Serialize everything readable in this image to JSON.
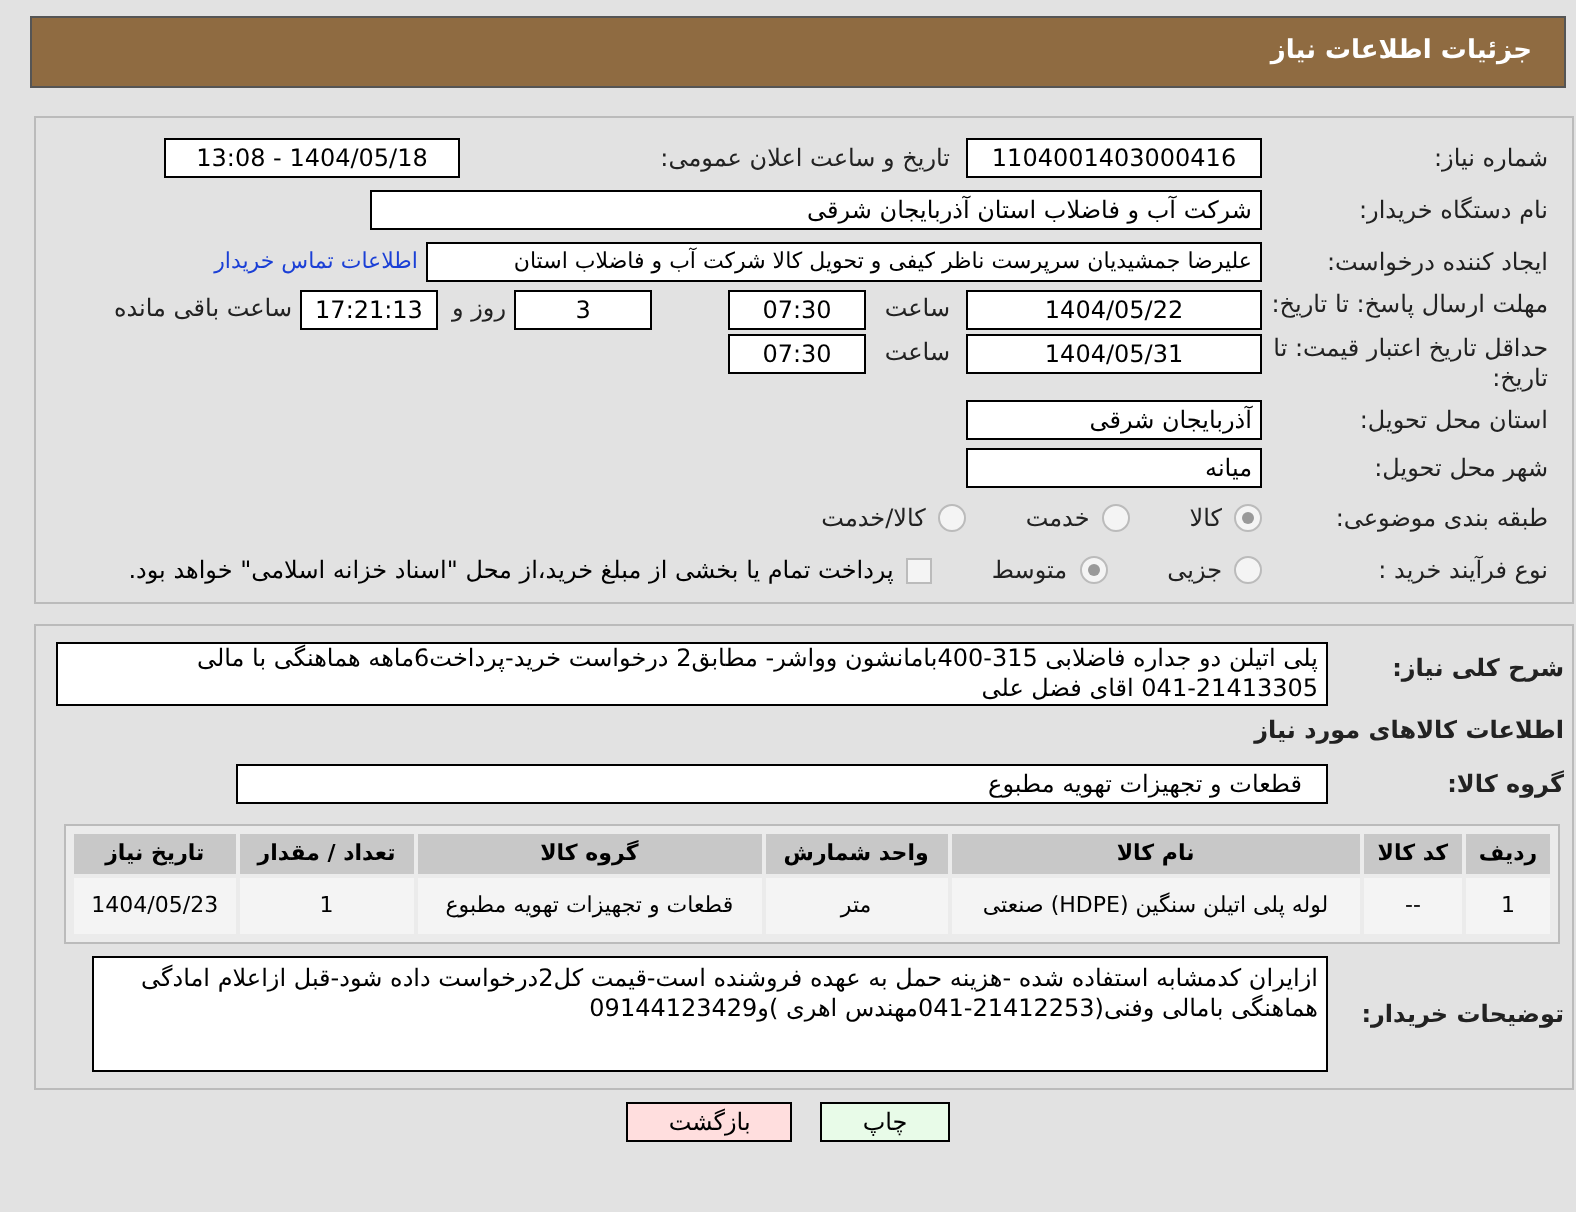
{
  "header": {
    "title": "جزئیات اطلاعات نیاز"
  },
  "need_number": {
    "label": "شماره نیاز:",
    "value": "1104001403000416"
  },
  "announce": {
    "label": "تاریخ و ساعت اعلان عمومی:",
    "value": "1404/05/18 - 13:08"
  },
  "buyer": {
    "label": "نام دستگاه خریدار:",
    "value": "شرکت آب و فاضلاب استان آذربایجان شرقی"
  },
  "requester": {
    "label": "ایجاد کننده درخواست:",
    "value": "علیرضا جمشیدیان سرپرست ناظر کیفی و تحویل کالا شرکت آب و فاضلاب استان",
    "link": "اطلاعات تماس خریدار"
  },
  "deadline": {
    "label": "مهلت ارسال پاسخ: تا تاریخ:",
    "date": "1404/05/22",
    "time_label": "ساعت",
    "time": "07:30",
    "days": "3",
    "days_label": "روز و",
    "remaining": "17:21:13",
    "remaining_label": "ساعت باقی مانده"
  },
  "validity": {
    "label": "حداقل تاریخ اعتبار قیمت: تا تاریخ:",
    "date": "1404/05/31",
    "time_label": "ساعت",
    "time": "07:30"
  },
  "province": {
    "label": "استان محل تحویل:",
    "value": "آذربایجان شرقی"
  },
  "city": {
    "label": "شهر محل تحویل:",
    "value": "میانه"
  },
  "category": {
    "label": "طبقه بندی موضوعی:",
    "options": [
      {
        "label": "کالا",
        "selected": true
      },
      {
        "label": "خدمت",
        "selected": false
      },
      {
        "label": "کالا/خدمت",
        "selected": false
      }
    ]
  },
  "process": {
    "label": "نوع فرآیند خرید :",
    "options": [
      {
        "label": "جزیی",
        "selected": false
      },
      {
        "label": "متوسط",
        "selected": true
      }
    ],
    "payment": {
      "label": "پرداخت تمام یا بخشی از مبلغ خرید،از محل \"اسناد خزانه اسلامی\" خواهد بود.",
      "checked": false
    }
  },
  "description": {
    "label": "شرح کلی نیاز:",
    "value": "پلی اتیلن دو جداره  فاضلابی 315-400بامانشون وواشر- مطابق2 درخواست خرید-پرداخت6ماهه هماهنگی با مالی 21413305-041 اقای فضل علی"
  },
  "goods_title": "اطلاعات کالاهای مورد نیاز",
  "goods_group": {
    "label": "گروه کالا:",
    "value": "قطعات و تجهیزات تهویه مطبوع"
  },
  "table": {
    "columns": [
      "ردیف",
      "کد کالا",
      "نام کالا",
      "واحد شمارش",
      "گروه کالا",
      "تعداد / مقدار",
      "تاریخ نیاز"
    ],
    "rows": [
      [
        "1",
        "--",
        "لوله پلی اتیلن سنگین (HDPE) صنعتی",
        "متر",
        "قطعات و تجهیزات تهویه مطبوع",
        "1",
        "1404/05/23"
      ]
    ]
  },
  "buyer_notes": {
    "label": "توضیحات خریدار:",
    "value": "ازایران کدمشابه استفاده شده -هزینه حمل به عهده فروشنده است-قیمت کل2درخواست داده شود-قبل ازاعلام امادگی هماهنگی بامالی وفنی(21412253-041مهندس اهری )و09144123429"
  },
  "buttons": [
    {
      "label": "چاپ",
      "kind": "print"
    },
    {
      "label": "بازگشت",
      "kind": "back"
    }
  ]
}
